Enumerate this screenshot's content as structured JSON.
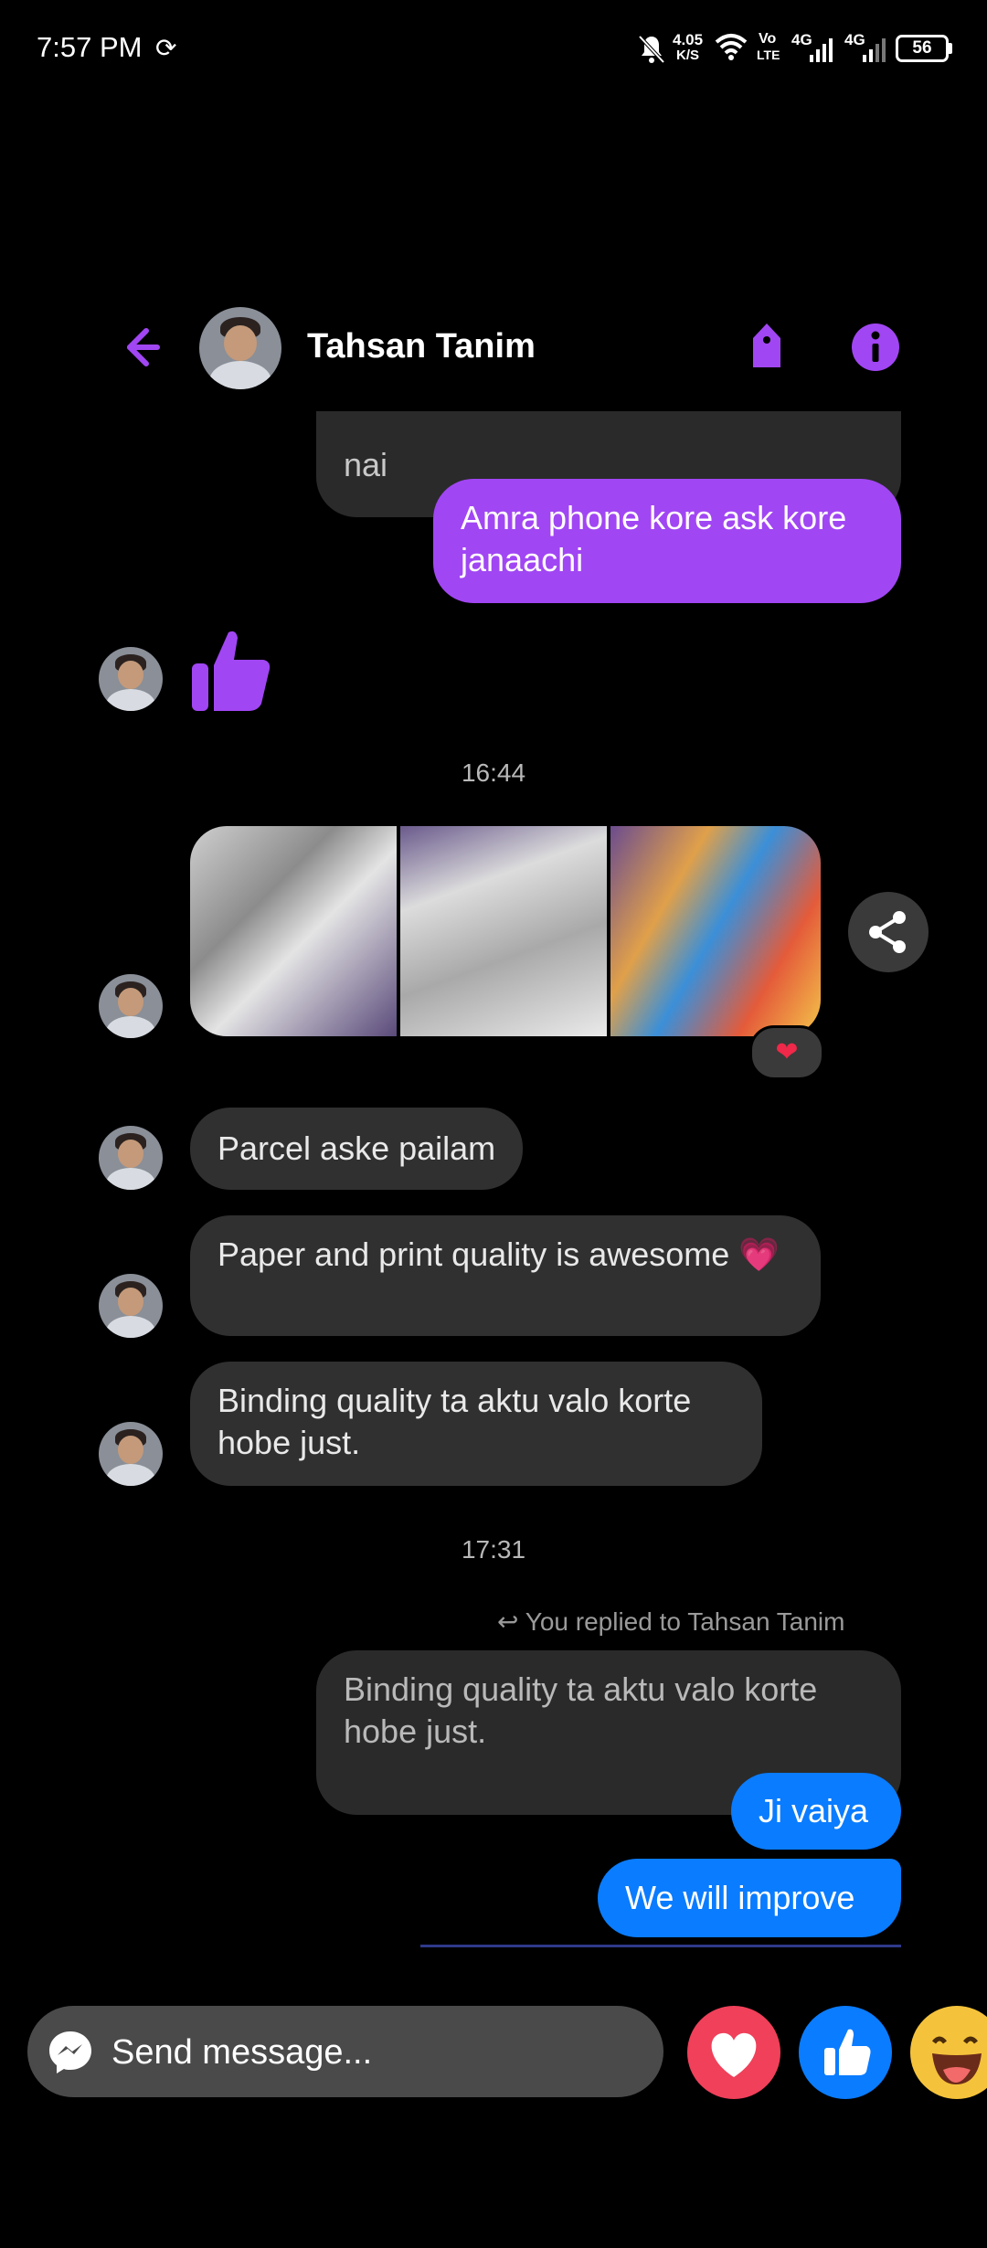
{
  "status_bar": {
    "time": "7:57 PM",
    "net_speed_value": "4.05",
    "net_speed_unit": "K/S",
    "volte_top": "Vo",
    "volte_bottom": "LTE",
    "sim1_type": "4G",
    "sim2_type": "4G",
    "battery": "56"
  },
  "header": {
    "contact_name": "Tahsan Tanim",
    "accent_color": "#a146f3"
  },
  "messages": {
    "partial_top_text": "nai",
    "out_msg_1": "Amra phone kore ask kore janaachi",
    "timestamp_1": "16:44",
    "photo_reaction": "❤",
    "in_msg_1": "Parcel aske pailam",
    "in_msg_2": "Paper and print quality is awesome 💗",
    "in_msg_3": "Binding quality ta aktu valo korte hobe just.",
    "timestamp_2": "17:31",
    "reply_context": "You replied to Tahsan Tanim",
    "quoted_msg": "Binding quality ta aktu valo korte hobe just.",
    "out_msg_2": "Ji vaiya",
    "out_msg_3": "We will improve"
  },
  "composer": {
    "placeholder": "Send message...",
    "reaction_heart_color": "#f0405a",
    "reaction_like_color": "#0a7cff"
  }
}
